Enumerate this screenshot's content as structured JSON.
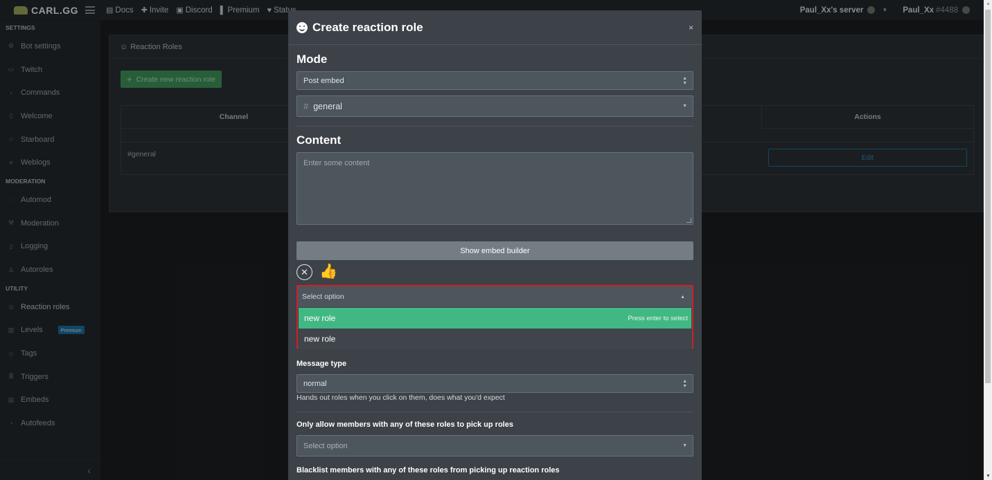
{
  "navbar": {
    "logo": "CARL.GG",
    "links": [
      {
        "icon": "book-icon",
        "label": "Docs"
      },
      {
        "icon": "plus-icon",
        "label": "Invite"
      },
      {
        "icon": "discord-icon",
        "label": "Discord"
      },
      {
        "icon": "patreon-icon",
        "label": "Premium"
      },
      {
        "icon": "heart-icon",
        "label": "Status"
      }
    ],
    "server": "Paul_Xx's server",
    "user": "Paul_Xx",
    "discriminator": "#4488"
  },
  "sidebar": {
    "sections": [
      {
        "title": "SETTINGS",
        "items": [
          "Bot settings",
          "Twitch",
          "Commands",
          "Welcome",
          "Starboard",
          "Weblogs"
        ]
      },
      {
        "title": "MODERATION",
        "items": [
          "Automod",
          "Moderation",
          "Logging",
          "Autoroles"
        ]
      },
      {
        "title": "UTILITY",
        "items": [
          "Reaction roles",
          "Levels",
          "Tags",
          "Triggers",
          "Embeds",
          "Autofeeds"
        ]
      }
    ],
    "premium_badge": "Premium",
    "collapse_icon": "chevron-left-icon"
  },
  "page": {
    "card_title": "Reaction Roles",
    "create_button": "Create new reaction role",
    "table": {
      "col_channel": "Channel",
      "col_actions": "Actions",
      "row_channel": "#general",
      "row_action": "Edit"
    }
  },
  "modal": {
    "title": "Create reaction role",
    "close": "×",
    "mode_heading": "Mode",
    "mode_value": "Post embed",
    "channel_value": "general",
    "content_heading": "Content",
    "content_placeholder": "Enter some content",
    "embed_builder_button": "Show embed builder",
    "emoji": "👍",
    "role_select": {
      "placeholder": "Select option",
      "options": [
        "new role",
        "new role"
      ],
      "hint": "Press enter to select"
    },
    "message_type_label": "Message type",
    "message_type_value": "normal",
    "message_type_help": "Hands out roles when you click on them, does what you'd expect",
    "allow_label": "Only allow members with any of these roles to pick up roles",
    "allow_placeholder": "Select option",
    "blacklist_label": "Blacklist members with any of these roles from picking up reaction roles"
  },
  "colors": {
    "accent_green": "#41b883",
    "highlight_red": "#d02028",
    "modal_bg": "#3c4248"
  }
}
